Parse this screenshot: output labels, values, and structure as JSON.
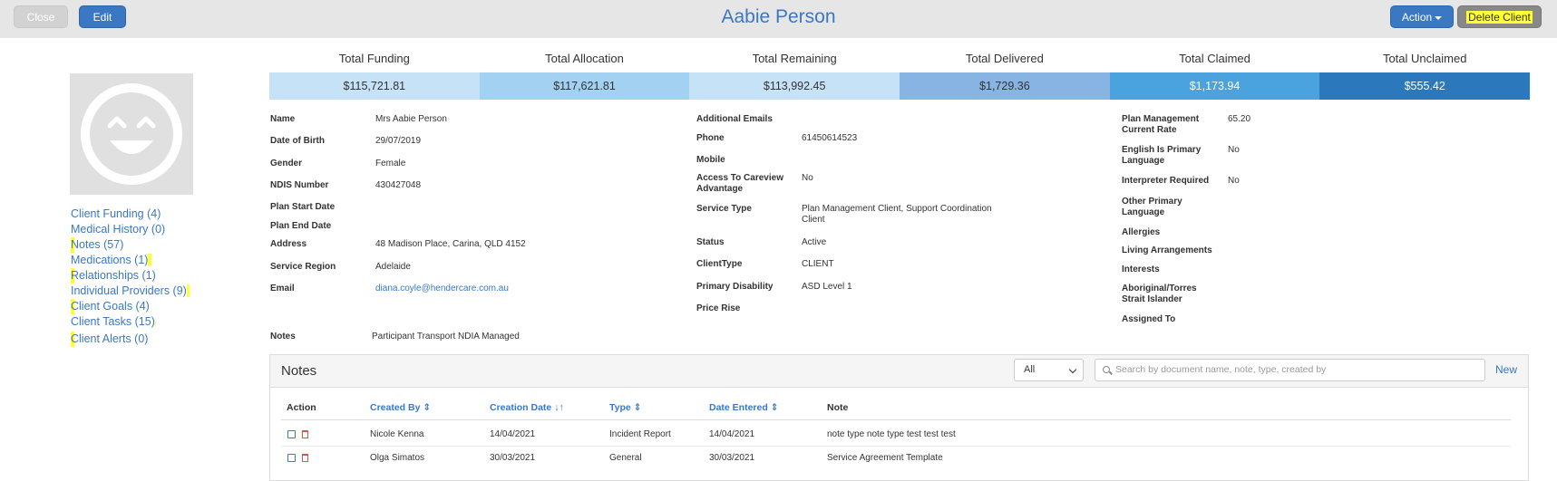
{
  "header": {
    "close_label": "Close",
    "edit_label": "Edit",
    "title": "Aabie Person",
    "action_label": "Action",
    "delete_label": "Delete Client"
  },
  "left_links": [
    {
      "label": "Client Funding (4)"
    },
    {
      "label": "Medical History (0)"
    },
    {
      "label": "Notes (57)"
    },
    {
      "label": "Medications (1)"
    },
    {
      "label": "Relationships (1)"
    },
    {
      "label": "Individual Providers (9)"
    },
    {
      "label": "Client Goals (4)"
    },
    {
      "label": "Client Tasks (15)"
    },
    {
      "label": "Client Alerts (0)"
    }
  ],
  "funding": [
    {
      "label": "Total Funding",
      "value": "$115,721.81",
      "bg": "#c6e2f6",
      "fg": "#333333"
    },
    {
      "label": "Total Allocation",
      "value": "$117,621.81",
      "bg": "#a3d1f2",
      "fg": "#333333"
    },
    {
      "label": "Total Remaining",
      "value": "$113,992.45",
      "bg": "#c6e2f6",
      "fg": "#333333"
    },
    {
      "label": "Total Delivered",
      "value": "$1,729.36",
      "bg": "#88b4e3",
      "fg": "#333333"
    },
    {
      "label": "Total Claimed",
      "value": "$1,173.94",
      "bg": "#4aa3df",
      "fg": "#ffffff"
    },
    {
      "label": "Total Unclaimed",
      "value": "$555.42",
      "bg": "#2b78bd",
      "fg": "#ffffff"
    }
  ],
  "details_col1": {
    "name_label": "Name",
    "name": "Mrs Aabie Person",
    "dob_label": "Date of Birth",
    "dob": "29/07/2019",
    "gender_label": "Gender",
    "gender": "Female",
    "ndis_label": "NDIS Number",
    "ndis": "430427048",
    "plan_start_label": "Plan Start Date",
    "plan_end_label": "Plan End Date",
    "address_label": "Address",
    "address": "48 Madison Place, Carina, QLD 4152",
    "region_label": "Service Region",
    "region": "Adelaide",
    "email_label": "Email",
    "email": "diana.coyle@hendercare.com.au",
    "notes_label": "Notes",
    "notes": "Participant Transport NDIA Managed"
  },
  "details_col2": {
    "add_emails_label": "Additional Emails",
    "phone_label": "Phone",
    "phone": "61450614523",
    "mobile_label": "Mobile",
    "careview_label_1": "Access To Careview",
    "careview_label_2": "Advantage",
    "careview": "No",
    "service_type_label": "Service Type",
    "service_type_1": "Plan Management Client, Support Coordination",
    "service_type_2": "Client",
    "status_label": "Status",
    "status": "Active",
    "clienttype_label": "ClientType",
    "clienttype": "CLIENT",
    "disability_label": "Primary Disability",
    "disability": "ASD Level 1",
    "price_rise_label": "Price Rise"
  },
  "details_col3": {
    "pm_rate_label_1": "Plan Management",
    "pm_rate_label_2": "Current Rate",
    "pm_rate": "65.20",
    "english_label_1": "English Is Primary",
    "english_label_2": "Language",
    "english": "No",
    "interpreter_label": "Interpreter Required",
    "interpreter": "No",
    "other_lang_label_1": "Other Primary",
    "other_lang_label_2": "Language",
    "allergies_label": "Allergies",
    "living_label": "Living Arrangements",
    "interests_label": "Interests",
    "aboriginal_label_1": "Aboriginal/Torres",
    "aboriginal_label_2": "Strait Islander",
    "assigned_label": "Assigned To"
  },
  "notes_panel": {
    "title": "Notes",
    "filter_value": "All",
    "search_placeholder": "Search by document name, note, type, created by",
    "new_label": "New",
    "columns": {
      "action": "Action",
      "created_by": "Created By",
      "creation_date": "Creation Date",
      "type": "Type",
      "date_entered": "Date Entered",
      "note": "Note"
    },
    "rows": [
      {
        "created_by": "Nicole Kenna",
        "creation_date": "14/04/2021",
        "type": "Incident Report",
        "date_entered": "14/04/2021",
        "note": "note type note type test test test"
      },
      {
        "created_by": "Olga Simatos",
        "creation_date": "30/03/2021",
        "type": "General",
        "date_entered": "30/03/2021",
        "note": "Service Agreement Template"
      }
    ]
  }
}
